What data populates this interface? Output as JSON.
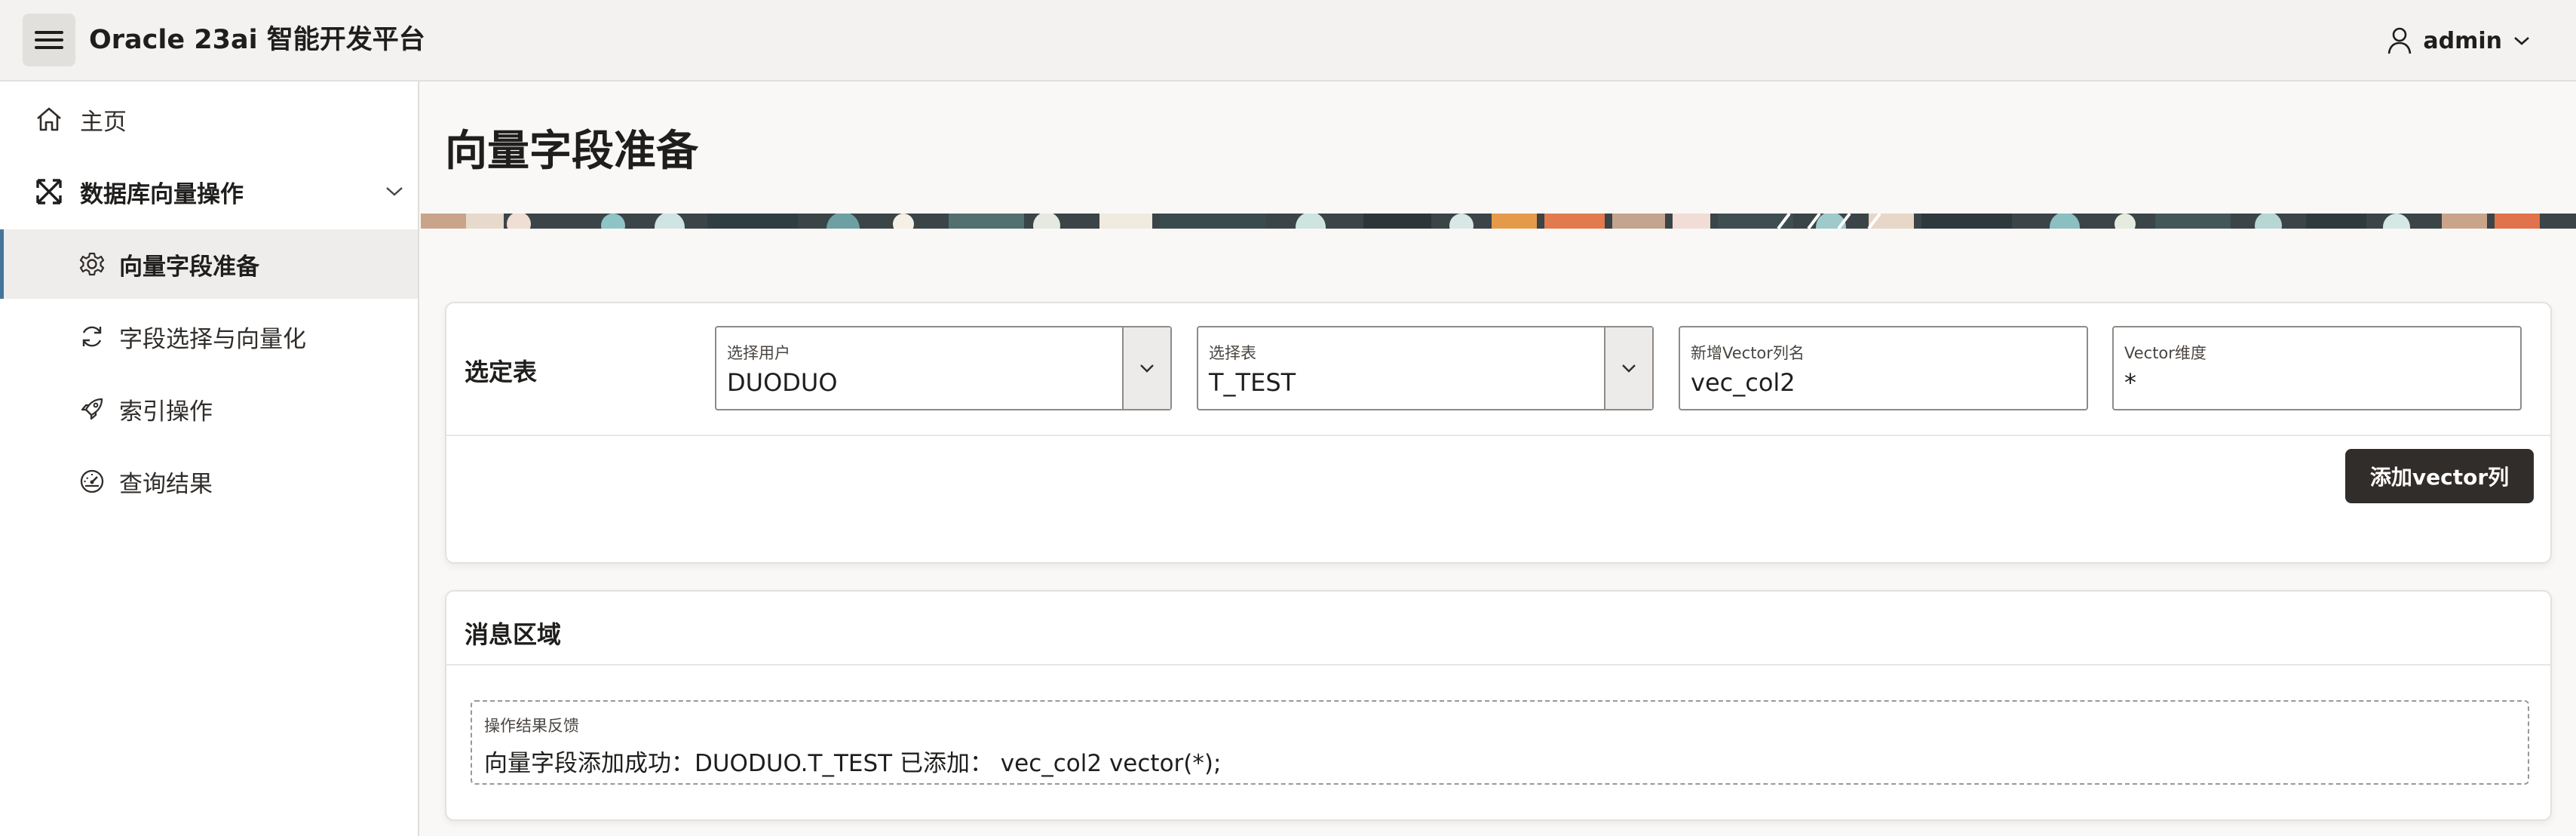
{
  "header": {
    "app_title": "Oracle 23ai 智能开发平台",
    "user_name": "admin",
    "menu_icon": "hamburger-icon",
    "user_icon": "user-icon"
  },
  "sidebar": {
    "items": [
      {
        "label": "主页",
        "icon": "home-icon"
      },
      {
        "label": "数据库向量操作",
        "icon": "expand-arrows-icon"
      },
      {
        "label": "向量字段准备",
        "icon": "gear-icon"
      },
      {
        "label": "字段选择与向量化",
        "icon": "refresh-icon"
      },
      {
        "label": "索引操作",
        "icon": "rocket-icon"
      },
      {
        "label": "查询结果",
        "icon": "speedometer-icon"
      }
    ]
  },
  "page": {
    "title": "向量字段准备"
  },
  "select_card": {
    "title": "选定表",
    "user_select": {
      "label": "选择用户",
      "value": "DUODUO"
    },
    "table_select": {
      "label": "选择表",
      "value": "T_TEST"
    },
    "vector_col": {
      "label": "新增Vector列名",
      "value": "vec_col2"
    },
    "vector_dim": {
      "label": "Vector维度",
      "value": "*"
    },
    "add_button": "添加vector列"
  },
  "message_card": {
    "title": "消息区域",
    "feedback_label": "操作结果反馈",
    "feedback_text": "向量字段添加成功：DUODUO.T_TEST 已添加： vec_col2 vector(*);"
  },
  "colors": {
    "accent": "#45759a",
    "button_dark": "#312d2a",
    "header_bg": "#f3f2f0",
    "page_bg": "#f9f8f6"
  }
}
